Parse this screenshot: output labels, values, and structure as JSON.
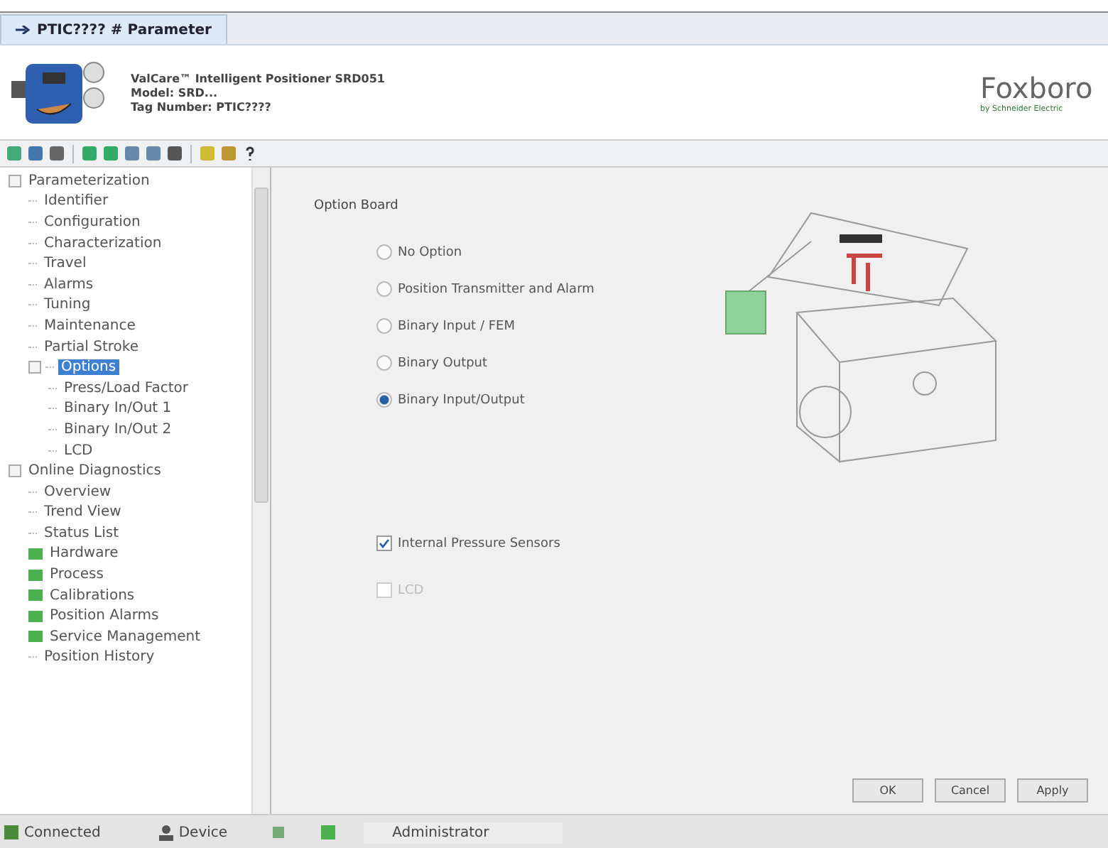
{
  "tab": {
    "title": "PTIC???? # Parameter",
    "selected": true
  },
  "header": {
    "lines": [
      "ValCare™ Intelligent Positioner SRD051",
      "Model: SRD...",
      "Tag Number: PTIC????"
    ],
    "logo": "Foxboro",
    "logo_sub": "by Schneider Electric"
  },
  "tree": [
    {
      "label": "Parameterization",
      "expanded": true,
      "selected": false,
      "children": [
        {
          "label": "Identifier",
          "kind": "page",
          "selected": false
        },
        {
          "label": "Configuration",
          "kind": "page",
          "selected": false
        },
        {
          "label": "Characterization",
          "kind": "page",
          "selected": false
        },
        {
          "label": "Travel",
          "kind": "page",
          "selected": false
        },
        {
          "label": "Alarms",
          "kind": "page",
          "selected": false
        },
        {
          "label": "Tuning",
          "kind": "page",
          "selected": false
        },
        {
          "label": "Maintenance",
          "kind": "page",
          "selected": false
        },
        {
          "label": "Partial Stroke",
          "kind": "page",
          "selected": false
        },
        {
          "label": "Options",
          "kind": "page",
          "selected": true,
          "expanded": true,
          "children": [
            {
              "label": "Press/Load Factor",
              "kind": "page",
              "selected": false
            },
            {
              "label": "Binary In/Out 1",
              "kind": "page",
              "selected": false
            },
            {
              "label": "Binary In/Out 2",
              "kind": "page",
              "selected": false
            },
            {
              "label": "LCD",
              "kind": "page",
              "selected": false
            }
          ]
        }
      ]
    },
    {
      "label": "Online Diagnostics",
      "expanded": true,
      "selected": false,
      "children": [
        {
          "label": "Overview",
          "kind": "page",
          "selected": false
        },
        {
          "label": "Trend View",
          "kind": "page",
          "selected": false
        },
        {
          "label": "Status List",
          "kind": "page",
          "selected": false
        },
        {
          "label": "Hardware",
          "kind": "status",
          "selected": false
        },
        {
          "label": "Process",
          "kind": "status",
          "selected": false
        },
        {
          "label": "Calibrations",
          "kind": "status",
          "selected": false
        },
        {
          "label": "Position Alarms",
          "kind": "status",
          "selected": false
        },
        {
          "label": "Service Management",
          "kind": "status",
          "selected": false
        },
        {
          "label": "Position History",
          "kind": "page",
          "selected": false
        }
      ]
    }
  ],
  "section_title": "Option Board",
  "options": [
    {
      "label": "No Option",
      "selected": false
    },
    {
      "label": "Position Transmitter and Alarm",
      "selected": false
    },
    {
      "label": "Binary Input / FEM",
      "selected": false
    },
    {
      "label": "Binary Output",
      "selected": false
    },
    {
      "label": "Binary Input/Output",
      "selected": true
    }
  ],
  "checkboxes": [
    {
      "label": "Internal Pressure Sensors",
      "checked": true,
      "disabled": false
    },
    {
      "label": "LCD",
      "checked": false,
      "disabled": true
    }
  ],
  "buttons": [
    "OK",
    "Cancel",
    "Apply"
  ],
  "status_bar": {
    "connection": "Connected",
    "device": "Device",
    "user": "Administrator"
  }
}
